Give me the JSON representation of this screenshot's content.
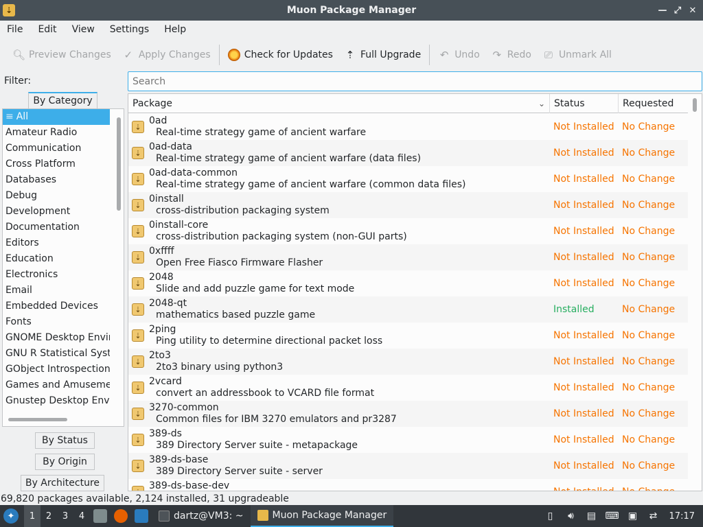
{
  "window": {
    "title": "Muon Package Manager"
  },
  "menubar": [
    "File",
    "Edit",
    "View",
    "Settings",
    "Help"
  ],
  "toolbar": {
    "preview": "Preview Changes",
    "apply": "Apply Changes",
    "check": "Check for Updates",
    "upgrade": "Full Upgrade",
    "undo": "Undo",
    "redo": "Redo",
    "unmark": "Unmark All"
  },
  "sidebar": {
    "filter_label": "Filter:",
    "by_category": "By Category",
    "categories": [
      "All",
      "Amateur Radio",
      "Communication",
      "Cross Platform",
      "Databases",
      "Debug",
      "Development",
      "Documentation",
      "Editors",
      "Education",
      "Electronics",
      "Email",
      "Embedded Devices",
      "Fonts",
      "GNOME Desktop Envir",
      "GNU R Statistical Syste",
      "GObject Introspection",
      "Games and Amusemen",
      "Gnustep Desktop Envir"
    ],
    "by_status": "By Status",
    "by_origin": "By Origin",
    "by_architecture": "By Architecture"
  },
  "search": {
    "placeholder": "Search"
  },
  "table": {
    "headers": {
      "package": "Package",
      "status": "Status",
      "requested": "Requested"
    },
    "rows": [
      {
        "name": "0ad",
        "desc": "Real-time strategy game of ancient warfare",
        "status": "Not Installed",
        "requested": "No Change"
      },
      {
        "name": "0ad-data",
        "desc": "Real-time strategy game of ancient warfare (data files)",
        "status": "Not Installed",
        "requested": "No Change"
      },
      {
        "name": "0ad-data-common",
        "desc": "Real-time strategy game of ancient warfare (common data files)",
        "status": "Not Installed",
        "requested": "No Change"
      },
      {
        "name": "0install",
        "desc": "cross-distribution packaging system",
        "status": "Not Installed",
        "requested": "No Change"
      },
      {
        "name": "0install-core",
        "desc": "cross-distribution packaging system (non-GUI parts)",
        "status": "Not Installed",
        "requested": "No Change"
      },
      {
        "name": "0xffff",
        "desc": "Open Free Fiasco Firmware Flasher",
        "status": "Not Installed",
        "requested": "No Change"
      },
      {
        "name": "2048",
        "desc": "Slide and add puzzle game for text mode",
        "status": "Not Installed",
        "requested": "No Change"
      },
      {
        "name": "2048-qt",
        "desc": "mathematics based puzzle game",
        "status": "Installed",
        "requested": "No Change"
      },
      {
        "name": "2ping",
        "desc": "Ping utility to determine directional packet loss",
        "status": "Not Installed",
        "requested": "No Change"
      },
      {
        "name": "2to3",
        "desc": "2to3 binary using python3",
        "status": "Not Installed",
        "requested": "No Change"
      },
      {
        "name": "2vcard",
        "desc": "convert an addressbook to VCARD file format",
        "status": "Not Installed",
        "requested": "No Change"
      },
      {
        "name": "3270-common",
        "desc": "Common files for IBM 3270 emulators and pr3287",
        "status": "Not Installed",
        "requested": "No Change"
      },
      {
        "name": "389-ds",
        "desc": "389 Directory Server suite - metapackage",
        "status": "Not Installed",
        "requested": "No Change"
      },
      {
        "name": "389-ds-base",
        "desc": "389 Directory Server suite - server",
        "status": "Not Installed",
        "requested": "No Change"
      },
      {
        "name": "389-ds-base-dev",
        "desc": "",
        "status": "Not Installed",
        "requested": "No Change"
      }
    ]
  },
  "statusbar": {
    "text": "69,820 packages available, 2,124 installed, 31 upgradeable"
  },
  "taskbar": {
    "workspaces": [
      "1",
      "2",
      "3",
      "4"
    ],
    "tasks": [
      {
        "label": "dartz@VM3: ~"
      },
      {
        "label": "Muon Package Manager"
      }
    ],
    "clock": "17:17"
  },
  "colors": {
    "accent": "#3daee9",
    "not_installed": "#f67400",
    "installed": "#27ae60"
  }
}
